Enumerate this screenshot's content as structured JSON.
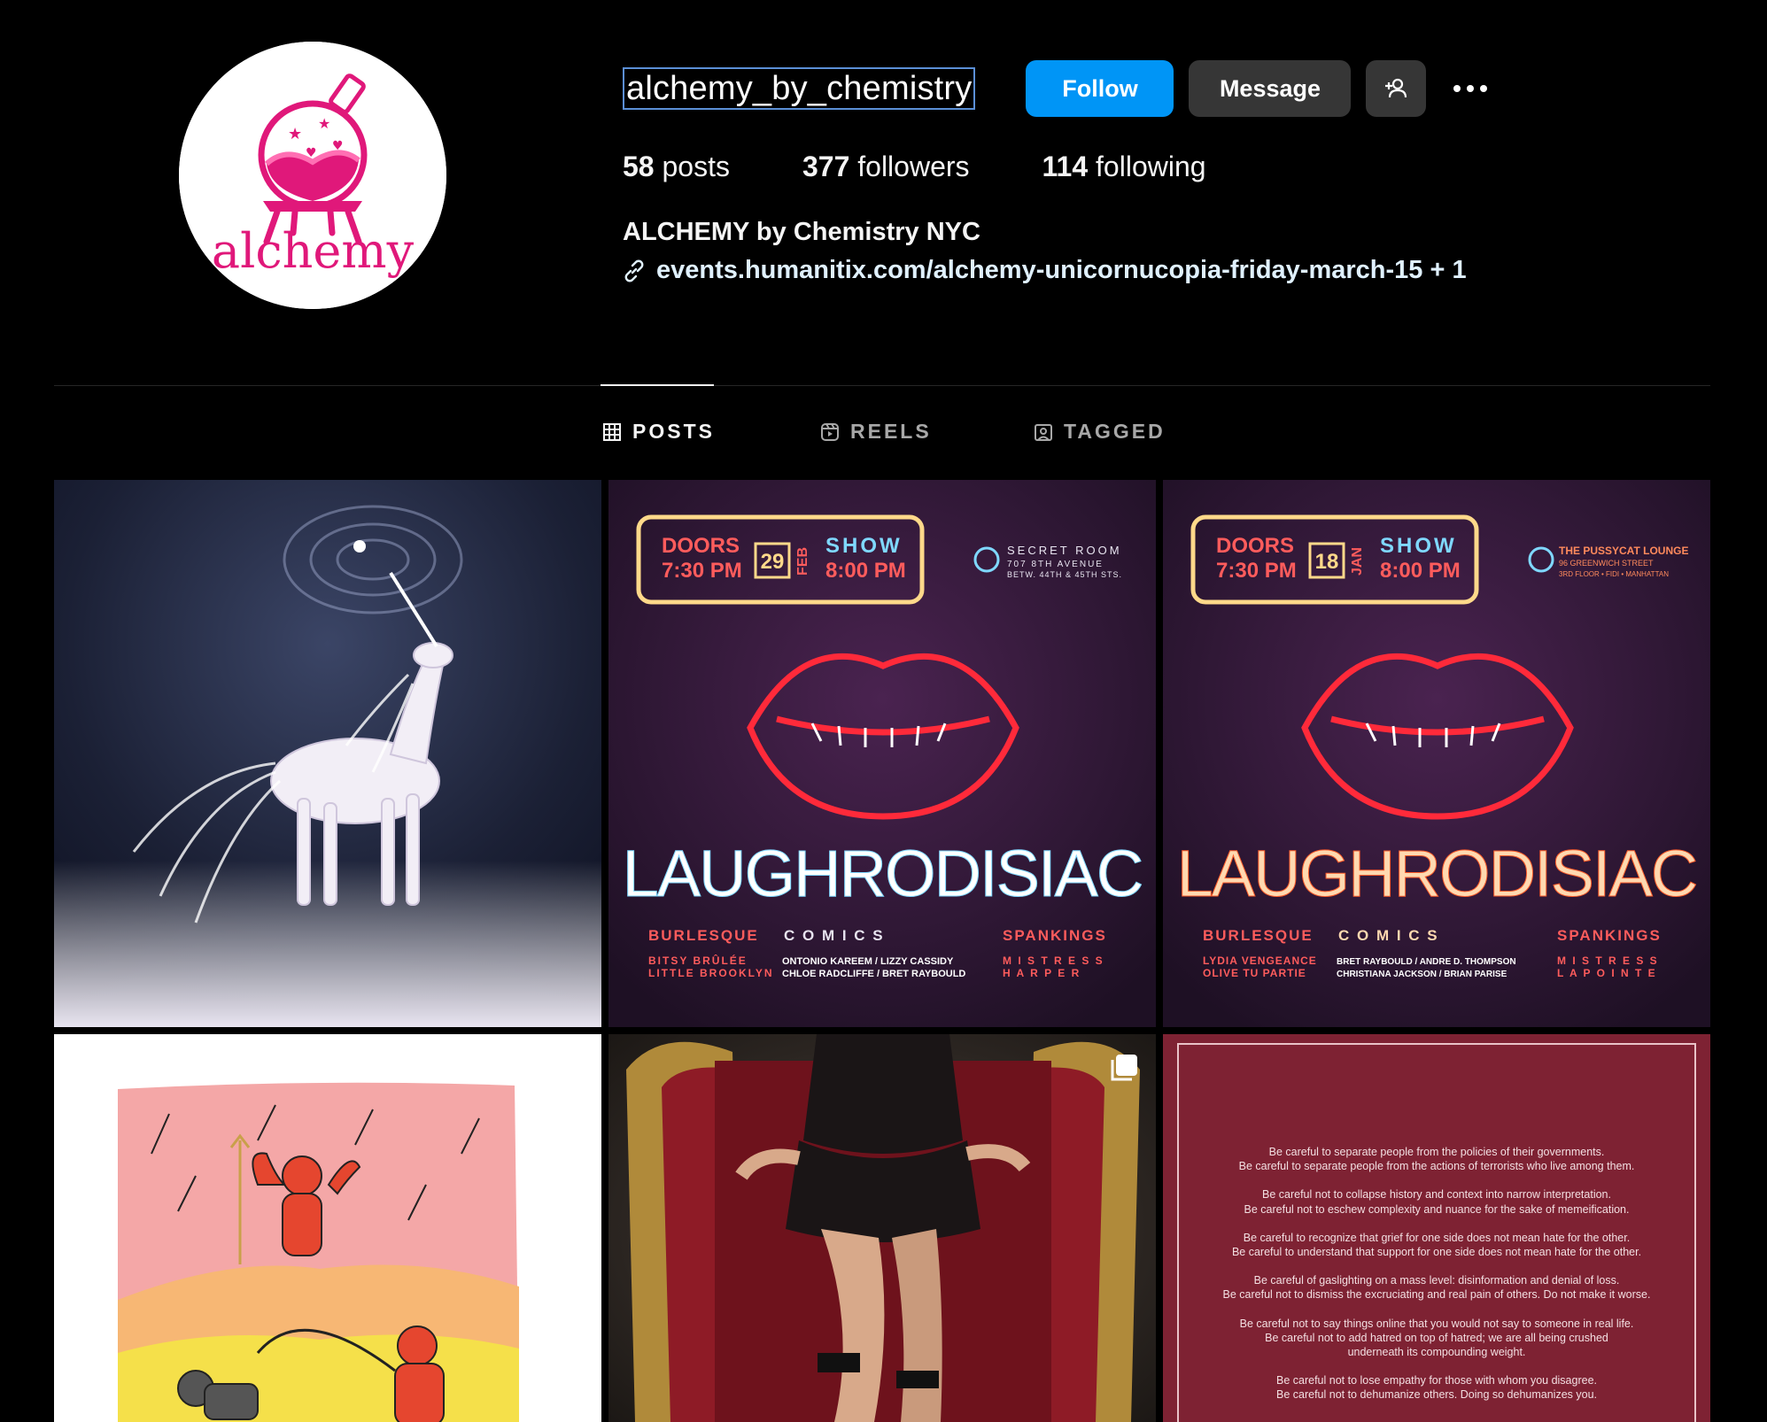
{
  "profile": {
    "username": "alchemy_by_chemistry",
    "avatar_text": "alchemy",
    "display_name": "ALCHEMY by Chemistry NYC",
    "link": "events.humanitix.com/alchemy-unicornucopia-friday-march-15 + 1"
  },
  "actions": {
    "follow": "Follow",
    "message": "Message",
    "add_user_icon": "add-user-icon",
    "more_icon": "more-options-icon"
  },
  "stats": {
    "posts_count": "58",
    "posts_label": "posts",
    "followers_count": "377",
    "followers_label": "followers",
    "following_count": "114",
    "following_label": "following"
  },
  "tabs": [
    {
      "label": "POSTS",
      "icon": "grid-icon",
      "active": true
    },
    {
      "label": "REELS",
      "icon": "reels-icon",
      "active": false
    },
    {
      "label": "TAGGED",
      "icon": "tagged-icon",
      "active": false
    }
  ],
  "flyer1": {
    "doors": "DOORS",
    "doors_time": "7:30 PM",
    "day": "29",
    "month": "FEB",
    "show": "SHOW",
    "show_time": "8:00 PM",
    "venue_line1": "SECRET ROOM",
    "venue_line2": "707 8TH AVENUE",
    "venue_line3": "BETW. 44TH & 45TH STS.",
    "title": "LAUGHRODISIAC",
    "col1_head": "BURLESQUE",
    "col2_head": "C O M I C S",
    "col3_head": "SPANKINGS",
    "col1_l1": "BITSY BRÛLÉE",
    "col1_l2": "LITTLE BROOKLYN",
    "col2_l1": "ONTONIO KAREEM / LIZZY CASSIDY",
    "col2_l2": "CHLOE RADCLIFFE / BRET RAYBOULD",
    "col3_l1": "M I S T R E S S",
    "col3_l2": "H A R P E R"
  },
  "flyer2": {
    "doors": "DOORS",
    "doors_time": "7:30 PM",
    "day": "18",
    "month": "JAN",
    "show": "SHOW",
    "show_time": "8:00 PM",
    "venue_line1": "THE PUSSYCAT LOUNGE",
    "venue_line2": "96 GREENWICH STREET",
    "venue_line3": "3RD FLOOR • FIDI • MANHATTAN",
    "title": "LAUGHRODISIAC",
    "col1_head": "BURLESQUE",
    "col2_head": "C O M I C S",
    "col3_head": "SPANKINGS",
    "col1_l1": "LYDIA VENGEANCE",
    "col1_l2": "OLIVE TU PARTIE",
    "col2_l1": "BRET RAYBOULD / ANDRE D. THOMPSON",
    "col2_l2": "CHRISTIANA JACKSON / BRIAN PARISE",
    "col3_l1": "M I S T R E S S",
    "col3_l2": "L A   P O I N T E"
  },
  "text_post": {
    "lines": [
      "Be careful to separate people from the policies of their governments.",
      "Be careful to separate people from the actions of terrorists who live among them.",
      "",
      "Be careful not to collapse history and context into narrow interpretation.",
      "Be careful not to eschew complexity and nuance for the sake of memeification.",
      "",
      "Be careful to recognize that grief for one side does not mean hate for the other.",
      "Be careful to understand that support for one side does not mean hate for the other.",
      "",
      "Be careful of gaslighting on a mass level: disinformation and denial of loss.",
      "Be careful not to dismiss the excruciating and real pain of others. Do not make it worse.",
      "",
      "Be careful not to say things online that you would not say to someone in real life.",
      "Be careful not to add hatred on top of hatred; we are all being crushed",
      "underneath its compounding weight.",
      "",
      "Be careful not to lose empathy for those with whom you disagree.",
      "Be careful not to dehumanize others. Doing so dehumanizes you."
    ]
  },
  "colors": {
    "follow_blue": "#0095f6",
    "button_gray": "#363636",
    "brand_pink": "#e0187a"
  }
}
